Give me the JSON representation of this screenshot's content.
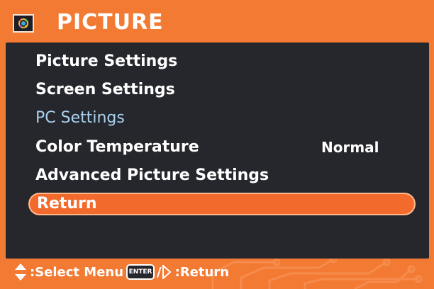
{
  "header": {
    "title": "PICTURE",
    "icon": "picture-menu-icon"
  },
  "menu": {
    "items": [
      {
        "label": "Picture Settings",
        "state": "normal"
      },
      {
        "label": "Screen Settings",
        "state": "normal"
      },
      {
        "label": "PC Settings",
        "state": "disabled"
      },
      {
        "label": "Color Temperature",
        "state": "normal",
        "value": "Normal"
      },
      {
        "label": "Advanced Picture Settings",
        "state": "normal"
      },
      {
        "label": "Return",
        "state": "selected"
      }
    ]
  },
  "footer": {
    "select_hint": ":Select Menu",
    "enter_key": "ENTER",
    "slash": "/",
    "return_hint": ":Return"
  },
  "colors": {
    "frame": "#f37a33",
    "panel": "#26272d",
    "highlight": "#f36a2d",
    "disabled_text": "#a9d2ef",
    "text": "#ffffff"
  }
}
